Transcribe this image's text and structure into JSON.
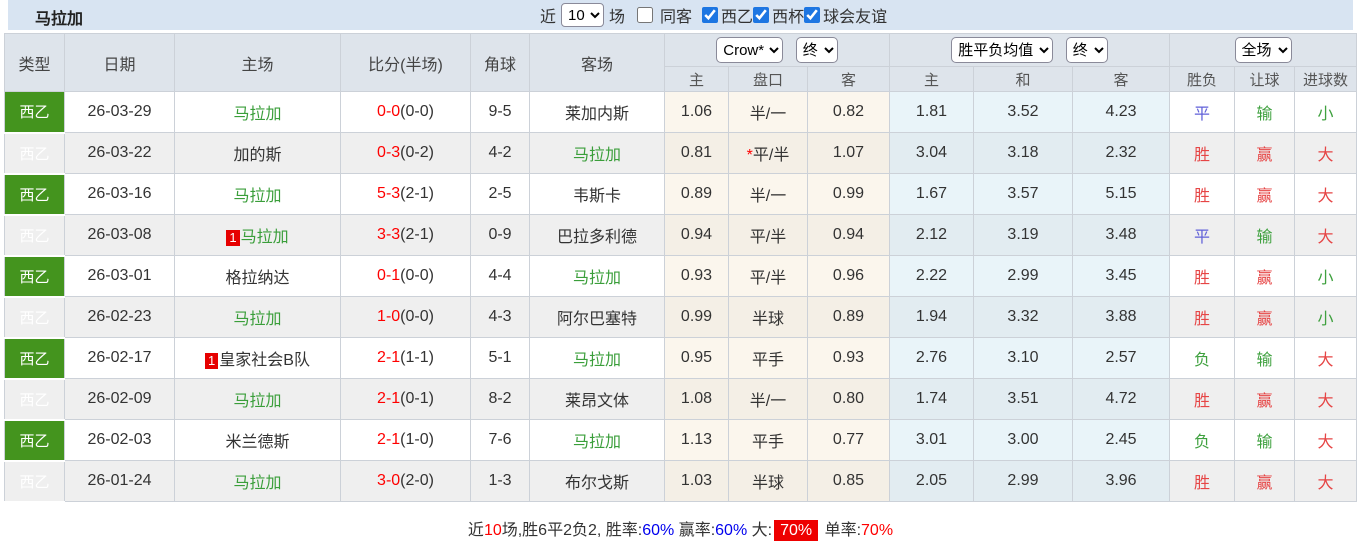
{
  "topbar": {
    "title": "马拉加",
    "recent_prefix": "近",
    "recent_value": "10",
    "recent_suffix": "场",
    "filters": [
      {
        "key": "same-venue",
        "label": "同客",
        "checked": false
      },
      {
        "key": "liga2",
        "label": "西乙",
        "checked": true
      },
      {
        "key": "copa",
        "label": "西杯",
        "checked": true
      },
      {
        "key": "friendly",
        "label": "球会友谊",
        "checked": true
      }
    ]
  },
  "table": {
    "headers": {
      "type": "类型",
      "date": "日期",
      "home": "主场",
      "score": "比分(半场)",
      "corner": "角球",
      "away": "客场",
      "odds_company_select": "Crow*",
      "odds_stage_select": "终",
      "odds_sub": [
        "主",
        "盘口",
        "客"
      ],
      "mean_select": "胜平负均值",
      "mean_stage_select": "终",
      "mean_sub": [
        "主",
        "和",
        "客"
      ],
      "scope_select": "全场",
      "result_sub": [
        "胜负",
        "让球",
        "进球数"
      ]
    },
    "result_colors": {
      "胜": "red",
      "平": "blue",
      "负": "green",
      "赢": "red",
      "输": "green",
      "大": "red",
      "小": "green"
    },
    "rows": [
      {
        "league": "西乙",
        "date": "26-03-29",
        "home": "马拉加",
        "home_green": true,
        "home_badge": false,
        "ft": "0-0",
        "ht": "(0-0)",
        "corner": "9-5",
        "away": "莱加内斯",
        "away_green": false,
        "o1": "1.06",
        "hc": "半/一",
        "hc_star": false,
        "o2": "0.82",
        "m1": "1.81",
        "m2": "3.52",
        "m3": "4.23",
        "r1": "平",
        "r2": "输",
        "r3": "小"
      },
      {
        "league": "西乙",
        "date": "26-03-22",
        "home": "加的斯",
        "home_green": false,
        "home_badge": false,
        "ft": "0-3",
        "ht": "(0-2)",
        "corner": "4-2",
        "away": "马拉加",
        "away_green": true,
        "o1": "0.81",
        "hc": "平/半",
        "hc_star": true,
        "o2": "1.07",
        "m1": "3.04",
        "m2": "3.18",
        "m3": "2.32",
        "r1": "胜",
        "r2": "赢",
        "r3": "大"
      },
      {
        "league": "西乙",
        "date": "26-03-16",
        "home": "马拉加",
        "home_green": true,
        "home_badge": false,
        "ft": "5-3",
        "ht": "(2-1)",
        "corner": "2-5",
        "away": "韦斯卡",
        "away_green": false,
        "o1": "0.89",
        "hc": "半/一",
        "hc_star": false,
        "o2": "0.99",
        "m1": "1.67",
        "m2": "3.57",
        "m3": "5.15",
        "r1": "胜",
        "r2": "赢",
        "r3": "大"
      },
      {
        "league": "西乙",
        "date": "26-03-08",
        "home": "马拉加",
        "home_green": true,
        "home_badge": true,
        "ft": "3-3",
        "ht": "(2-1)",
        "corner": "0-9",
        "away": "巴拉多利德",
        "away_green": false,
        "o1": "0.94",
        "hc": "平/半",
        "hc_star": false,
        "o2": "0.94",
        "m1": "2.12",
        "m2": "3.19",
        "m3": "3.48",
        "r1": "平",
        "r2": "输",
        "r3": "大"
      },
      {
        "league": "西乙",
        "date": "26-03-01",
        "home": "格拉纳达",
        "home_green": false,
        "home_badge": false,
        "ft": "0-1",
        "ht": "(0-0)",
        "corner": "4-4",
        "away": "马拉加",
        "away_green": true,
        "o1": "0.93",
        "hc": "平/半",
        "hc_star": false,
        "o2": "0.96",
        "m1": "2.22",
        "m2": "2.99",
        "m3": "3.45",
        "r1": "胜",
        "r2": "赢",
        "r3": "小"
      },
      {
        "league": "西乙",
        "date": "26-02-23",
        "home": "马拉加",
        "home_green": true,
        "home_badge": false,
        "ft": "1-0",
        "ht": "(0-0)",
        "corner": "4-3",
        "away": "阿尔巴塞特",
        "away_green": false,
        "o1": "0.99",
        "hc": "半球",
        "hc_star": false,
        "o2": "0.89",
        "m1": "1.94",
        "m2": "3.32",
        "m3": "3.88",
        "r1": "胜",
        "r2": "赢",
        "r3": "小"
      },
      {
        "league": "西乙",
        "date": "26-02-17",
        "home": "皇家社会B队",
        "home_green": false,
        "home_badge": true,
        "ft": "2-1",
        "ht": "(1-1)",
        "corner": "5-1",
        "away": "马拉加",
        "away_green": true,
        "o1": "0.95",
        "hc": "平手",
        "hc_star": false,
        "o2": "0.93",
        "m1": "2.76",
        "m2": "3.10",
        "m3": "2.57",
        "r1": "负",
        "r2": "输",
        "r3": "大"
      },
      {
        "league": "西乙",
        "date": "26-02-09",
        "home": "马拉加",
        "home_green": true,
        "home_badge": false,
        "ft": "2-1",
        "ht": "(0-1)",
        "corner": "8-2",
        "away": "莱昂文体",
        "away_green": false,
        "o1": "1.08",
        "hc": "半/一",
        "hc_star": false,
        "o2": "0.80",
        "m1": "1.74",
        "m2": "3.51",
        "m3": "4.72",
        "r1": "胜",
        "r2": "赢",
        "r3": "大"
      },
      {
        "league": "西乙",
        "date": "26-02-03",
        "home": "米兰德斯",
        "home_green": false,
        "home_badge": false,
        "ft": "2-1",
        "ht": "(1-0)",
        "corner": "7-6",
        "away": "马拉加",
        "away_green": true,
        "o1": "1.13",
        "hc": "平手",
        "hc_star": false,
        "o2": "0.77",
        "m1": "3.01",
        "m2": "3.00",
        "m3": "2.45",
        "r1": "负",
        "r2": "输",
        "r3": "大"
      },
      {
        "league": "西乙",
        "date": "26-01-24",
        "home": "马拉加",
        "home_green": true,
        "home_badge": false,
        "ft": "3-0",
        "ht": "(2-0)",
        "corner": "1-3",
        "away": "布尔戈斯",
        "away_green": false,
        "o1": "1.03",
        "hc": "半球",
        "hc_star": false,
        "o2": "0.85",
        "m1": "2.05",
        "m2": "2.99",
        "m3": "3.96",
        "r1": "胜",
        "r2": "赢",
        "r3": "大"
      }
    ]
  },
  "summary": {
    "segments": [
      {
        "text": "近",
        "style": "dark"
      },
      {
        "text": "10",
        "style": "red"
      },
      {
        "text": "场,胜6平2负2, 胜率:",
        "style": "dark"
      },
      {
        "text": "60%",
        "style": "blue"
      },
      {
        "text": " 赢率:",
        "style": "dark"
      },
      {
        "text": "60%",
        "style": "blue"
      },
      {
        "text": " 大:",
        "style": "dark"
      },
      {
        "text": "70%",
        "style": "badge"
      },
      {
        "text": " 单率:",
        "style": "dark"
      },
      {
        "text": "70%",
        "style": "red"
      }
    ]
  },
  "colors": {
    "league_badge_bg": "#44941e",
    "team_highlight_green": "#3a9e3a",
    "score_fulltime_red": "#ff0000",
    "result_red": "#e64545",
    "result_green": "#3fa13f",
    "result_blue": "#6161d8",
    "summary_blue": "#0000ee",
    "summary_badge_bg": "#ee0000",
    "topbar_bg": "#d8e4f2",
    "header_bg": "#dee4eb",
    "crow_column_bg": "#fbf6ed",
    "mean_column_bg": "#e9f4f9"
  }
}
